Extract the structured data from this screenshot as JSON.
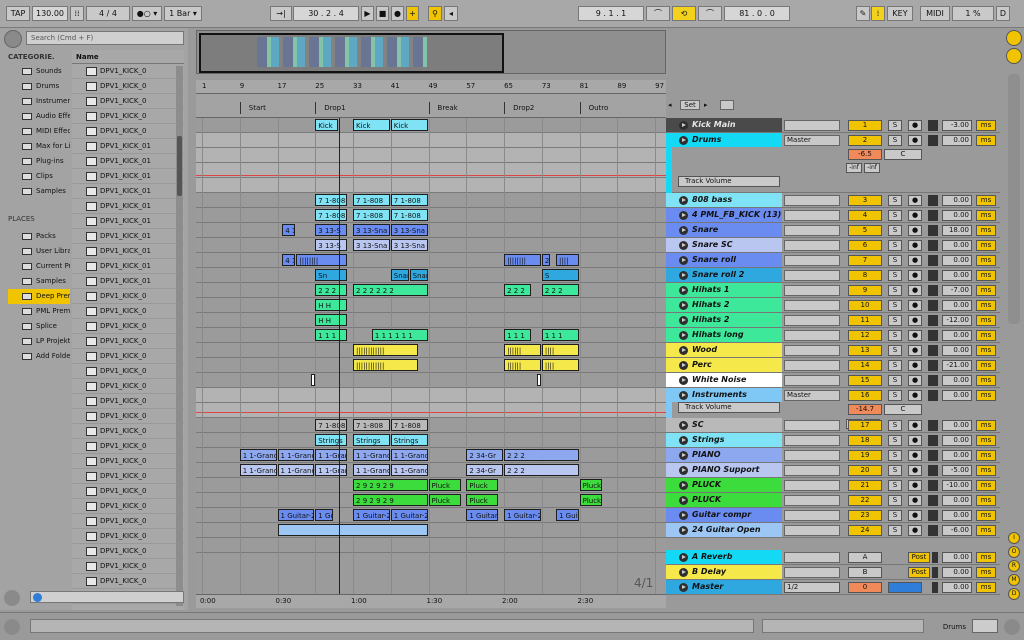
{
  "transport": {
    "tap": "TAP",
    "tempo": "130.00",
    "sig": "4 / 4",
    "quant": "1 Bar",
    "position": "30 .   2 .   4",
    "loop_start": "9 .   1 .   1",
    "loop_len": "81 .   0 .   0",
    "key": "KEY",
    "midi": "MIDI",
    "cpu": "1 %",
    "d": "D"
  },
  "browser": {
    "search_placeholder": "Search (Cmd + F)",
    "categories_title": "CATEGORIE.",
    "categories": [
      "Sounds",
      "Drums",
      "Instrument",
      "Audio Effe",
      "MIDI Effec",
      "Max for Liv",
      "Plug-ins",
      "Clips",
      "Samples"
    ],
    "places_title": "PLACES",
    "places": [
      "Packs",
      "User Libra",
      "Current Pr",
      "Samples",
      "Deep Prem",
      "PML Prem",
      "Splice",
      "LP Projekt",
      "Add Folder..."
    ],
    "name_header": "Name",
    "files": [
      "DPV1_KICK_0",
      "DPV1_KICK_0",
      "DPV1_KICK_0",
      "DPV1_KICK_0",
      "DPV1_KICK_0",
      "DPV1_KICK_01",
      "DPV1_KICK_01",
      "DPV1_KICK_01",
      "DPV1_KICK_01",
      "DPV1_KICK_01",
      "DPV1_KICK_01",
      "DPV1_KICK_01",
      "DPV1_KICK_01",
      "DPV1_KICK_01",
      "DPV1_KICK_01",
      "DPV1_KICK_0",
      "DPV1_KICK_0",
      "DPV1_KICK_0",
      "DPV1_KICK_0",
      "DPV1_KICK_0",
      "DPV1_KICK_0",
      "DPV1_KICK_0",
      "DPV1_KICK_0",
      "DPV1_KICK_0",
      "DPV1_KICK_0",
      "DPV1_KICK_0",
      "DPV1_KICK_0",
      "DPV1_KICK_0",
      "DPV1_KICK_0",
      "DPV1_KICK_0",
      "DPV1_KICK_0",
      "DPV1_KICK_0",
      "DPV1_KICK_0",
      "DPV1_KICK_0",
      "DPV1_KICK_0",
      "DPV1_KICK_0"
    ]
  },
  "ruler": {
    "bars": [
      "1",
      "9",
      "17",
      "25",
      "33",
      "41",
      "49",
      "57",
      "65",
      "73",
      "81",
      "89",
      "97"
    ],
    "locators": [
      "Start",
      "Drop1",
      "Break",
      "Drop2",
      "Outro"
    ],
    "set": "Set",
    "times": [
      "0:00",
      "0:30",
      "1:00",
      "1:30",
      "2:00",
      "2:30"
    ],
    "sig": "4/1"
  },
  "arrangement_clips": [
    {
      "label": "Kick",
      "color": "#7fe3f5",
      "bar": 25,
      "len": 5,
      "row": 0
    },
    {
      "label": "Kick",
      "color": "#7fe3f5",
      "bar": 33,
      "len": 8,
      "row": 0
    },
    {
      "label": "Kick",
      "color": "#7fe3f5",
      "bar": 41,
      "len": 8,
      "row": 0
    },
    {
      "label": "7 1-808",
      "color": "#7fe3f5",
      "bar": 25,
      "len": 7,
      "row": 5
    },
    {
      "label": "7 1-808",
      "color": "#7fe3f5",
      "bar": 33,
      "len": 8,
      "row": 5
    },
    {
      "label": "7 1-808",
      "color": "#7fe3f5",
      "bar": 41,
      "len": 8,
      "row": 5
    },
    {
      "label": "7 1-808",
      "color": "#7fe3f5",
      "bar": 25,
      "len": 7,
      "row": 6
    },
    {
      "label": "7 1-808",
      "color": "#7fe3f5",
      "bar": 33,
      "len": 8,
      "row": 6
    },
    {
      "label": "7 1-808",
      "color": "#7fe3f5",
      "bar": 41,
      "len": 8,
      "row": 6
    },
    {
      "label": "4 1",
      "color": "#6a8cf0",
      "bar": 18,
      "len": 3,
      "row": 7
    },
    {
      "label": "3 13-S",
      "color": "#6a8cf0",
      "bar": 25,
      "len": 7,
      "row": 7
    },
    {
      "label": "3 13-Sna",
      "color": "#6a8cf0",
      "bar": 33,
      "len": 8,
      "row": 7
    },
    {
      "label": "3 13-Sna",
      "color": "#6a8cf0",
      "bar": 41,
      "len": 8,
      "row": 7
    },
    {
      "label": "3 13-S",
      "color": "#b9c6f0",
      "bar": 25,
      "len": 7,
      "row": 8
    },
    {
      "label": "3 13-Sna",
      "color": "#b9c6f0",
      "bar": 33,
      "len": 8,
      "row": 8
    },
    {
      "label": "3 13-Sna",
      "color": "#b9c6f0",
      "bar": 41,
      "len": 8,
      "row": 8
    },
    {
      "label": "4 1",
      "color": "#6a8cf0",
      "bar": 18,
      "len": 3,
      "row": 9
    },
    {
      "label": "||||||||",
      "color": "#6a8cf0",
      "bar": 21,
      "len": 11,
      "row": 9
    },
    {
      "label": "||||||||",
      "color": "#6a8cf0",
      "bar": 65,
      "len": 8,
      "row": 9
    },
    {
      "label": "2",
      "color": "#6a8cf0",
      "bar": 73,
      "len": 2,
      "row": 9
    },
    {
      "label": "||||",
      "color": "#6a8cf0",
      "bar": 76,
      "len": 5,
      "row": 9
    },
    {
      "label": "Sn",
      "color": "#2fa8e0",
      "bar": 25,
      "len": 7,
      "row": 10
    },
    {
      "label": "Snar",
      "color": "#2fa8e0",
      "bar": 41,
      "len": 4,
      "row": 10
    },
    {
      "label": "Snar",
      "color": "#2fa8e0",
      "bar": 45,
      "len": 4,
      "row": 10
    },
    {
      "label": "S",
      "color": "#2fa8e0",
      "bar": 73,
      "len": 8,
      "row": 10
    },
    {
      "label": "2 2 2",
      "color": "#3de89a",
      "bar": 25,
      "len": 7,
      "row": 11
    },
    {
      "label": "2 2 2 2 2 2",
      "color": "#3de89a",
      "bar": 33,
      "len": 16,
      "row": 11
    },
    {
      "label": "2 2 2",
      "color": "#3de89a",
      "bar": 65,
      "len": 6,
      "row": 11
    },
    {
      "label": "2 2 2",
      "color": "#3de89a",
      "bar": 73,
      "len": 8,
      "row": 11
    },
    {
      "label": "H H",
      "color": "#3de89a",
      "bar": 25,
      "len": 7,
      "row": 12
    },
    {
      "label": "H H",
      "color": "#3de89a",
      "bar": 25,
      "len": 7,
      "row": 13
    },
    {
      "label": "1 1 1",
      "color": "#3de89a",
      "bar": 25,
      "len": 7,
      "row": 14
    },
    {
      "label": "1 1 1 1 1 1",
      "color": "#3de89a",
      "bar": 37,
      "len": 12,
      "row": 14
    },
    {
      "label": "1 1 1",
      "color": "#3de89a",
      "bar": 65,
      "len": 6,
      "row": 14
    },
    {
      "label": "1 1 1",
      "color": "#3de89a",
      "bar": 73,
      "len": 8,
      "row": 14
    },
    {
      "label": "||||||||||||",
      "color": "#f5e84a",
      "bar": 33,
      "len": 14,
      "row": 15
    },
    {
      "label": "||||||",
      "color": "#f5e84a",
      "bar": 65,
      "len": 8,
      "row": 15
    },
    {
      "label": "||||",
      "color": "#f5e84a",
      "bar": 73,
      "len": 8,
      "row": 15
    },
    {
      "label": "||||||||||||",
      "color": "#f5e84a",
      "bar": 33,
      "len": 14,
      "row": 16
    },
    {
      "label": "||||||",
      "color": "#f5e84a",
      "bar": 65,
      "len": 8,
      "row": 16
    },
    {
      "label": "||||",
      "color": "#f5e84a",
      "bar": 73,
      "len": 8,
      "row": 16
    },
    {
      "label": "W",
      "color": "#ffffff",
      "bar": 24,
      "len": 1,
      "row": 17
    },
    {
      "label": "W",
      "color": "#ffffff",
      "bar": 72,
      "len": 1,
      "row": 17
    },
    {
      "label": "7 1-808",
      "color": "#b9b9b9",
      "bar": 25,
      "len": 7,
      "row": 20
    },
    {
      "label": "7 1-808",
      "color": "#b9b9b9",
      "bar": 33,
      "len": 8,
      "row": 20
    },
    {
      "label": "7 1-808",
      "color": "#b9b9b9",
      "bar": 41,
      "len": 8,
      "row": 20
    },
    {
      "label": "Strings",
      "color": "#7fe3f5",
      "bar": 25,
      "len": 7,
      "row": 21
    },
    {
      "label": "Strings",
      "color": "#7fe3f5",
      "bar": 33,
      "len": 8,
      "row": 21
    },
    {
      "label": "Strings",
      "color": "#7fe3f5",
      "bar": 41,
      "len": 8,
      "row": 21
    },
    {
      "label": "1 1-Grand",
      "color": "#8ea8f0",
      "bar": 9,
      "len": 8,
      "row": 22
    },
    {
      "label": "1 1-Grand",
      "color": "#8ea8f0",
      "bar": 17,
      "len": 8,
      "row": 22
    },
    {
      "label": "1 1-Gran",
      "color": "#8ea8f0",
      "bar": 25,
      "len": 7,
      "row": 22
    },
    {
      "label": "1 1-Grand",
      "color": "#8ea8f0",
      "bar": 33,
      "len": 8,
      "row": 22
    },
    {
      "label": "1 1-Grand",
      "color": "#8ea8f0",
      "bar": 41,
      "len": 8,
      "row": 22
    },
    {
      "label": "2 34-Gr",
      "color": "#8ea8f0",
      "bar": 57,
      "len": 8,
      "row": 22
    },
    {
      "label": "2 2 2",
      "color": "#8ea8f0",
      "bar": 65,
      "len": 16,
      "row": 22
    },
    {
      "label": "1 1-Grand",
      "color": "#b9c6f0",
      "bar": 9,
      "len": 8,
      "row": 23
    },
    {
      "label": "1 1-Grand",
      "color": "#b9c6f0",
      "bar": 17,
      "len": 8,
      "row": 23
    },
    {
      "label": "1 1-Gran",
      "color": "#b9c6f0",
      "bar": 25,
      "len": 7,
      "row": 23
    },
    {
      "label": "1 1-Grand",
      "color": "#b9c6f0",
      "bar": 33,
      "len": 8,
      "row": 23
    },
    {
      "label": "1 1-Grand",
      "color": "#b9c6f0",
      "bar": 41,
      "len": 8,
      "row": 23
    },
    {
      "label": "2 34-Gr",
      "color": "#b9c6f0",
      "bar": 57,
      "len": 8,
      "row": 23
    },
    {
      "label": "2 2 2",
      "color": "#b9c6f0",
      "bar": 65,
      "len": 16,
      "row": 23
    },
    {
      "label": "2 9 2 9 2 9",
      "color": "#3ddc3d",
      "bar": 33,
      "len": 16,
      "row": 24
    },
    {
      "label": "Pluck",
      "color": "#3ddc3d",
      "bar": 49,
      "len": 7,
      "row": 24
    },
    {
      "label": "Pluck",
      "color": "#3ddc3d",
      "bar": 57,
      "len": 7,
      "row": 24
    },
    {
      "label": "Pluck",
      "color": "#3ddc3d",
      "bar": 81,
      "len": 5,
      "row": 24
    },
    {
      "label": "2 9 2 9 2 9",
      "color": "#3ddc3d",
      "bar": 33,
      "len": 16,
      "row": 25
    },
    {
      "label": "Pluck",
      "color": "#3ddc3d",
      "bar": 49,
      "len": 7,
      "row": 25
    },
    {
      "label": "Pluck",
      "color": "#3ddc3d",
      "bar": 57,
      "len": 7,
      "row": 25
    },
    {
      "label": "Pluck",
      "color": "#3ddc3d",
      "bar": 81,
      "len": 5,
      "row": 25
    },
    {
      "label": "1 Guitar-2",
      "color": "#6a8cf0",
      "bar": 17,
      "len": 8,
      "row": 26
    },
    {
      "label": "1 Guit",
      "color": "#6a8cf0",
      "bar": 25,
      "len": 4,
      "row": 26
    },
    {
      "label": "1 Guitar-2",
      "color": "#6a8cf0",
      "bar": 33,
      "len": 8,
      "row": 26
    },
    {
      "label": "1 Guitar-2",
      "color": "#6a8cf0",
      "bar": 41,
      "len": 8,
      "row": 26
    },
    {
      "label": "1 Guitar",
      "color": "#6a8cf0",
      "bar": 57,
      "len": 7,
      "row": 26
    },
    {
      "label": "1 Guitar-2",
      "color": "#6a8cf0",
      "bar": 65,
      "len": 8,
      "row": 26
    },
    {
      "label": "1 Guita",
      "color": "#6a8cf0",
      "bar": 76,
      "len": 5,
      "row": 26
    },
    {
      "label": "",
      "color": "#9cc7f5",
      "bar": 17,
      "len": 32,
      "row": 27
    }
  ],
  "tracks": [
    {
      "name": "Kick Main",
      "color": "#4a4a4a",
      "textcolor": "#e6e6e6",
      "num": "1",
      "vol": "-3.00",
      "row": 0
    },
    {
      "name": "Drums",
      "color": "#13d9f5",
      "num": "2",
      "vol": "0.00",
      "row": 1,
      "group": true
    },
    {
      "name": "808 bass",
      "color": "#7fe3f5",
      "num": "3",
      "vol": "0.00",
      "row": 5
    },
    {
      "name": "4 PML_FB_KICK (13)",
      "color": "#6a8cf0",
      "num": "4",
      "vol": "0.00",
      "row": 6
    },
    {
      "name": "Snare",
      "color": "#6a8cf0",
      "num": "5",
      "vol": "18.00",
      "row": 7
    },
    {
      "name": "Snare SC",
      "color": "#b9c6f0",
      "num": "6",
      "vol": "0.00",
      "row": 8
    },
    {
      "name": "Snare roll",
      "color": "#6a8cf0",
      "num": "7",
      "vol": "0.00",
      "row": 9
    },
    {
      "name": "Snare roll 2",
      "color": "#2fa8e0",
      "num": "8",
      "vol": "0.00",
      "row": 10
    },
    {
      "name": "Hihats 1",
      "color": "#3de89a",
      "num": "9",
      "vol": "-7.00",
      "row": 11
    },
    {
      "name": "Hihats 2",
      "color": "#3de89a",
      "num": "10",
      "vol": "0.00",
      "row": 12
    },
    {
      "name": "Hihats 2",
      "color": "#3de89a",
      "num": "11",
      "vol": "-12.00",
      "row": 13
    },
    {
      "name": "Hihats long",
      "color": "#3de89a",
      "num": "12",
      "vol": "0.00",
      "row": 14
    },
    {
      "name": "Wood",
      "color": "#f5e84a",
      "num": "13",
      "vol": "0.00",
      "row": 15
    },
    {
      "name": "Perc",
      "color": "#f5e84a",
      "num": "14",
      "vol": "-21.00",
      "row": 16
    },
    {
      "name": "White Noise",
      "color": "#ffffff",
      "num": "15",
      "vol": "0.00",
      "row": 17
    },
    {
      "name": "Instruments",
      "color": "#7fc8f5",
      "num": "16",
      "vol": "0.00",
      "row": 18,
      "group": true
    },
    {
      "name": "SC",
      "color": "#b9b9b9",
      "num": "17",
      "vol": "0.00",
      "row": 20
    },
    {
      "name": "Strings",
      "color": "#7fe3f5",
      "num": "18",
      "vol": "0.00",
      "row": 21
    },
    {
      "name": "PIANO",
      "color": "#8ea8f0",
      "num": "19",
      "vol": "0.00",
      "row": 22
    },
    {
      "name": "PIANO Support",
      "color": "#b9c6f0",
      "num": "20",
      "vol": "-5.00",
      "row": 23
    },
    {
      "name": "PLUCK",
      "color": "#3ddc3d",
      "num": "21",
      "vol": "-10.00",
      "row": 24
    },
    {
      "name": "PLUCK",
      "color": "#3ddc3d",
      "num": "22",
      "vol": "0.00",
      "row": 25
    },
    {
      "name": "Guitar compr",
      "color": "#6a8cf0",
      "num": "23",
      "vol": "0.00",
      "row": 26
    },
    {
      "name": "24 Guitar Open",
      "color": "#9cc7f5",
      "num": "24",
      "vol": "-6.00",
      "row": 27
    }
  ],
  "returns": [
    {
      "name": "A Reverb",
      "color": "#13d9f5",
      "letter": "A",
      "vol": "0.00",
      "post": "Post"
    },
    {
      "name": "B Delay",
      "color": "#f5e84a",
      "letter": "B",
      "vol": "0.00",
      "post": "Post"
    },
    {
      "name": "Master",
      "color": "#2fa8e0",
      "letter": "0",
      "vol": "0.00",
      "routing": "1/2"
    }
  ],
  "group_ctrl": {
    "master": "Master",
    "track_volume": "Track Volume",
    "drums_db": "-6.5",
    "inst_db": "-14.7",
    "c": "C",
    "inf": "-inf",
    "ms": "ms",
    "s": "S"
  },
  "side_letters": [
    "I",
    "O",
    "R",
    "M",
    "D"
  ],
  "status": {
    "track": "Drums"
  }
}
